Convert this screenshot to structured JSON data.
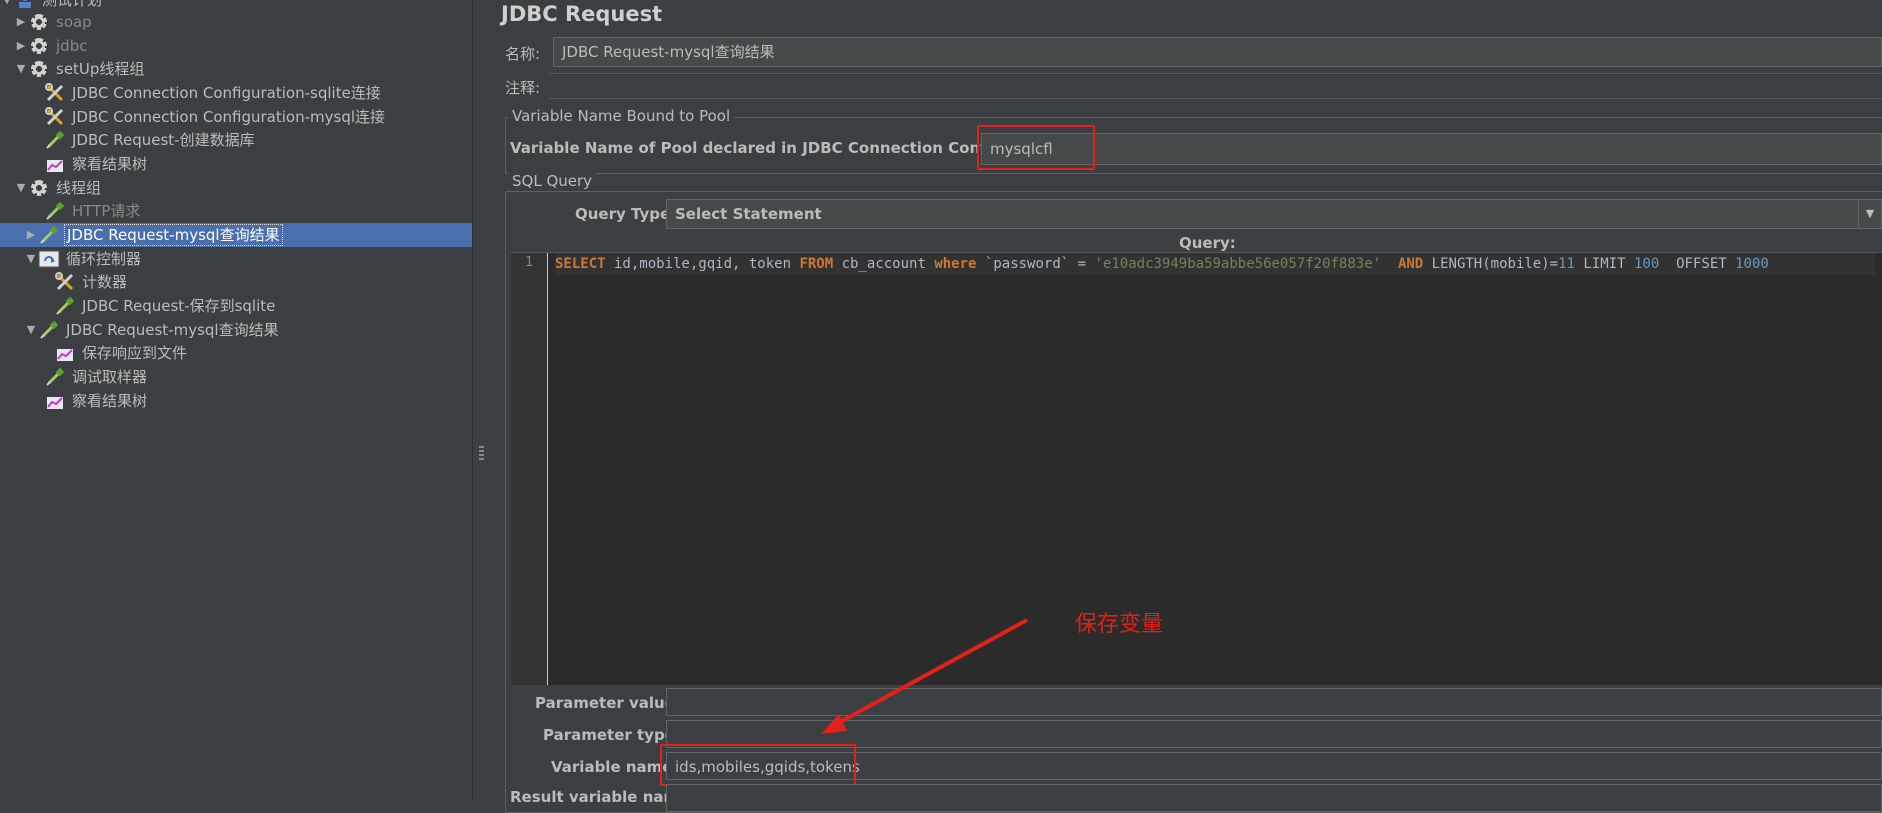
{
  "tree": {
    "items": [
      {
        "label": "测试计划",
        "icon": "test-plan-icon",
        "expanded": true
      },
      {
        "label": "soap",
        "icon": "gear-icon",
        "disabled": true
      },
      {
        "label": "jdbc",
        "icon": "gear-icon",
        "disabled": true
      },
      {
        "label": "setUp线程组",
        "icon": "gear-icon"
      },
      {
        "label": "JDBC Connection Configuration-sqlite连接",
        "icon": "wrench-icon"
      },
      {
        "label": "JDBC Connection Configuration-mysql连接",
        "icon": "wrench-icon"
      },
      {
        "label": "JDBC Request-创建数据库",
        "icon": "pipette-icon"
      },
      {
        "label": "察看结果树",
        "icon": "graph-icon"
      },
      {
        "label": "线程组",
        "icon": "gear-icon"
      },
      {
        "label": "HTTP请求",
        "icon": "pipette-icon",
        "disabled": true
      },
      {
        "label": "JDBC Request-mysql查询结果",
        "icon": "pipette-icon",
        "selected": true
      },
      {
        "label": "循环控制器",
        "icon": "loop-icon"
      },
      {
        "label": "计数器",
        "icon": "wrench-icon"
      },
      {
        "label": "JDBC Request-保存到sqlite",
        "icon": "pipette-icon"
      },
      {
        "label": "JDBC Request-mysql查询结果",
        "icon": "pipette-icon"
      },
      {
        "label": "保存响应到文件",
        "icon": "graph-icon"
      },
      {
        "label": "调试取样器",
        "icon": "pipette-icon"
      },
      {
        "label": "察看结果树",
        "icon": "graph-icon"
      }
    ]
  },
  "panel": {
    "title": "JDBC Request",
    "name_label": "名称:",
    "name_value": "JDBC Request-mysql查询结果",
    "comment_label": "注释:",
    "comment_value": "",
    "pool_section": "Variable Name Bound to Pool",
    "pool_label": "Variable Name of Pool declared in JDBC Connection Configuration:",
    "pool_value": "mysqlcfl",
    "sql_section": "SQL Query",
    "query_type_label": "Query Type:",
    "query_type_value": "Select Statement",
    "query_label": "Query:",
    "line_number": "1",
    "sql_tokens": [
      {
        "t": "SELECT",
        "c": "kw"
      },
      {
        "t": " id,mobile,gqid, token ",
        "c": "plain"
      },
      {
        "t": "FROM",
        "c": "kw"
      },
      {
        "t": " cb_account ",
        "c": "plain"
      },
      {
        "t": "where",
        "c": "kw"
      },
      {
        "t": " `password` = ",
        "c": "plain"
      },
      {
        "t": "'e10adc3949ba59abbe56e057f20f883e'",
        "c": "str"
      },
      {
        "t": "  ",
        "c": "plain"
      },
      {
        "t": "AND",
        "c": "kw"
      },
      {
        "t": " LENGTH(mobile)=",
        "c": "plain"
      },
      {
        "t": "11",
        "c": "num"
      },
      {
        "t": " LIMIT ",
        "c": "plain"
      },
      {
        "t": "100",
        "c": "num"
      },
      {
        "t": "  OFFSET ",
        "c": "plain"
      },
      {
        "t": "1000",
        "c": "num"
      }
    ],
    "param_values_label": "Parameter values:",
    "param_values_value": "",
    "param_types_label": "Parameter types:",
    "param_types_value": "",
    "variable_names_label": "Variable names:",
    "variable_names_value": "ids,mobiles,gqids,tokens",
    "result_variable_label": "Result variable name:",
    "result_variable_value": ""
  },
  "annotation": {
    "text": "保存变量",
    "color": "#e0211a"
  }
}
